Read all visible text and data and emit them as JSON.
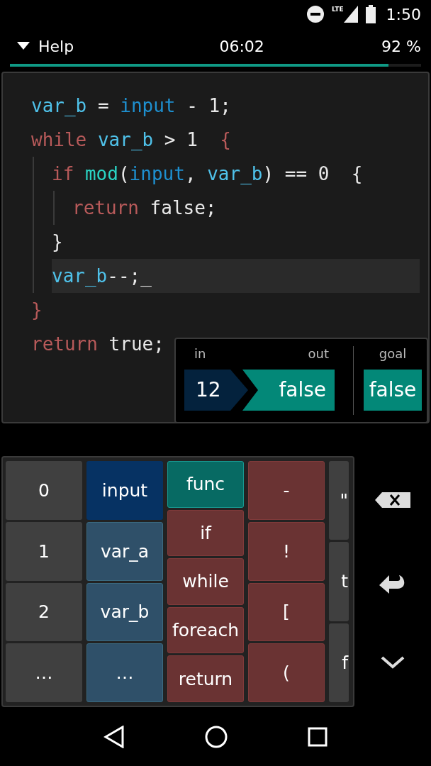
{
  "status_bar": {
    "time": "1:50",
    "network": "LTE"
  },
  "header": {
    "menu": "Help",
    "timer": "06:02",
    "score": "92 %",
    "progress": {
      "level": 0.92
    }
  },
  "code": [
    {
      "tokens": [
        {
          "text": "var_b",
          "kind": "var"
        },
        {
          "text": " = ",
          "kind": "plain"
        },
        {
          "text": "input",
          "kind": "input"
        },
        {
          "text": " - 1;",
          "kind": "plain"
        }
      ],
      "selected": false
    },
    {
      "tokens": [
        {
          "text": "while",
          "kind": "keyword"
        },
        {
          "text": " var_b",
          "kind": "var"
        },
        {
          "text": " > 1  ",
          "kind": "plain"
        },
        {
          "text": "{",
          "kind": "keyword"
        }
      ],
      "selected": false,
      "children": [
        {
          "tokens": [
            {
              "text": "if",
              "kind": "keyword"
            },
            {
              "text": " mod",
              "kind": "func"
            },
            {
              "text": "(",
              "kind": "plain"
            },
            {
              "text": "input",
              "kind": "input"
            },
            {
              "text": ", ",
              "kind": "plain"
            },
            {
              "text": "var_b",
              "kind": "var"
            },
            {
              "text": ") == 0  {",
              "kind": "plain"
            }
          ],
          "selected": false,
          "children": [
            {
              "tokens": [
                {
                  "text": "return",
                  "kind": "keyword"
                },
                {
                  "text": " false;",
                  "kind": "plain"
                }
              ],
              "selected": false
            }
          ]
        },
        {
          "tokens": [
            {
              "text": "}",
              "kind": "plain"
            }
          ],
          "selected": false
        },
        {
          "tokens": [
            {
              "text": "var_b",
              "kind": "var"
            },
            {
              "text": "--;_",
              "kind": "plain"
            }
          ],
          "selected": true
        }
      ]
    },
    {
      "tokens": [
        {
          "text": "}",
          "kind": "keyword"
        }
      ],
      "selected": false
    },
    {
      "tokens": [
        {
          "text": "return",
          "kind": "keyword"
        },
        {
          "text": " true;",
          "kind": "plain"
        }
      ],
      "selected": false
    }
  ],
  "result": {
    "in_label": "in",
    "out_label": "out",
    "goal_label": "goal",
    "in": "12",
    "out": "false",
    "goal": "false"
  },
  "keyboard": [
    [
      {
        "label": "0",
        "kind": "number"
      },
      {
        "label": "1",
        "kind": "number"
      },
      {
        "label": "2",
        "kind": "number"
      },
      {
        "label": "…",
        "kind": "number"
      }
    ],
    [
      {
        "label": "input",
        "kind": "input"
      },
      {
        "label": "var_a",
        "kind": "var"
      },
      {
        "label": "var_b",
        "kind": "var"
      },
      {
        "label": "…",
        "kind": "var"
      }
    ],
    [
      {
        "label": "func",
        "kind": "func"
      },
      {
        "label": "if",
        "kind": "keyword"
      },
      {
        "label": "while",
        "kind": "keyword"
      },
      {
        "label": "foreach",
        "kind": "keyword"
      },
      {
        "label": "return",
        "kind": "keyword"
      }
    ],
    [
      {
        "label": "-",
        "kind": "keyword"
      },
      {
        "label": "!",
        "kind": "keyword"
      },
      {
        "label": "[",
        "kind": "keyword"
      },
      {
        "label": "(",
        "kind": "keyword"
      }
    ],
    [
      {
        "label": "\"",
        "kind": "number"
      },
      {
        "label": "t",
        "kind": "number"
      },
      {
        "label": "f",
        "kind": "number"
      }
    ]
  ]
}
